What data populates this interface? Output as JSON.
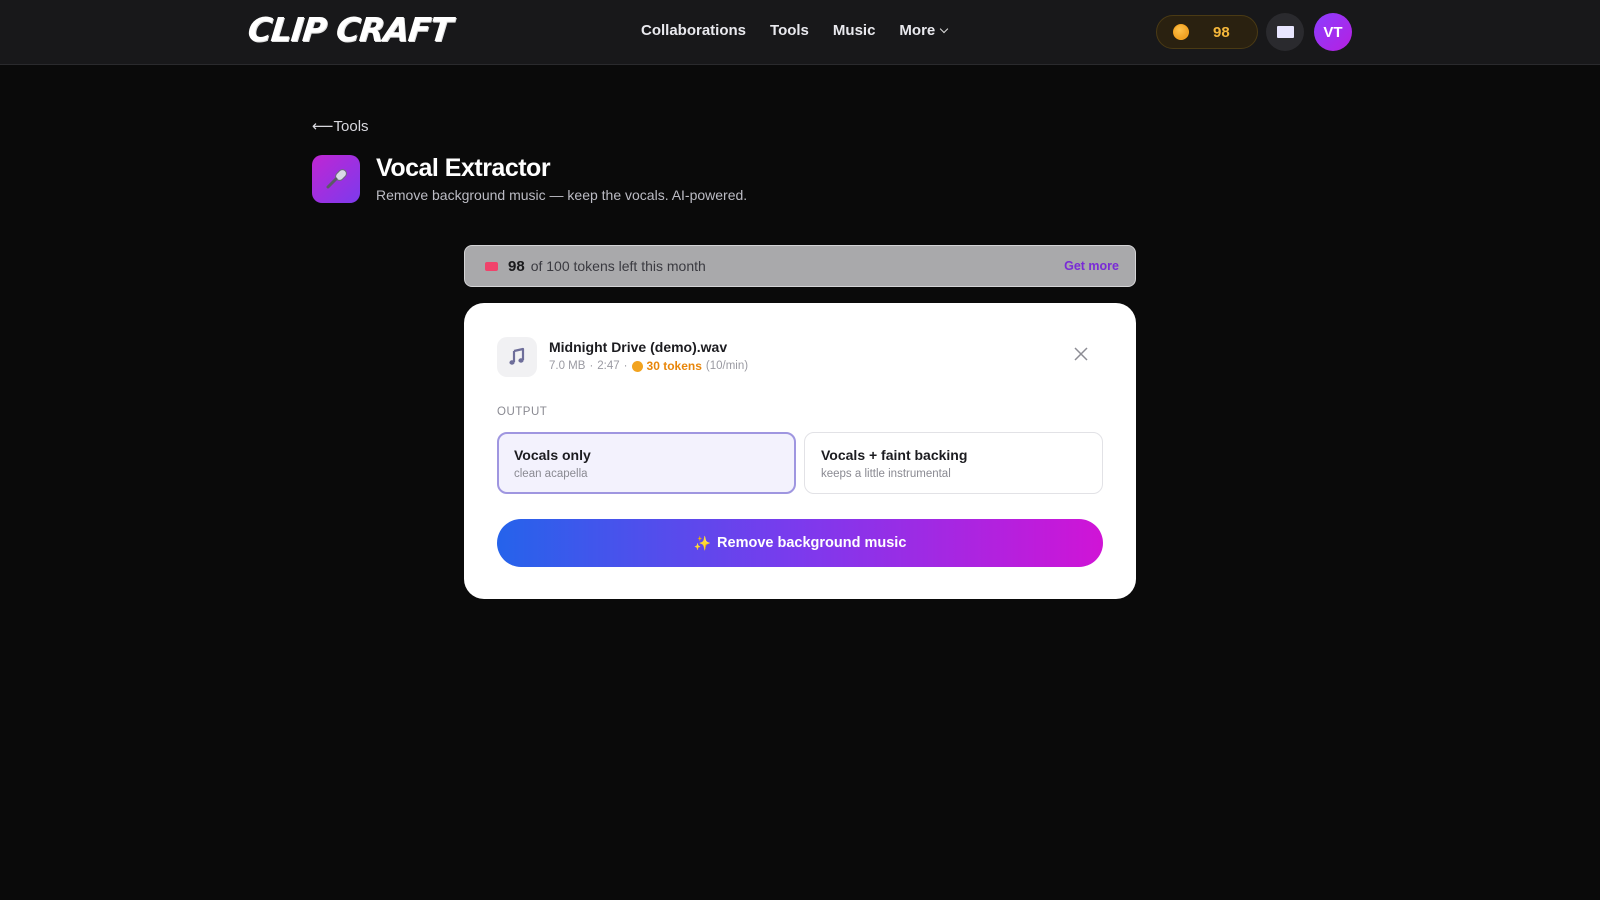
{
  "header": {
    "logo_text": "CLIP CRAFT",
    "nav": [
      {
        "label": "Collaborations"
      },
      {
        "label": "Tools"
      },
      {
        "label": "Music"
      },
      {
        "label": "More"
      }
    ],
    "token_count": "98",
    "avatar_initials": "VT"
  },
  "page": {
    "back_label": "Tools",
    "back_arrow": "⟵",
    "title": "Vocal Extractor",
    "subtitle": "Remove background music — keep the vocals. AI-powered.",
    "icon": "microphone-icon"
  },
  "quota": {
    "remaining": "98",
    "text": "of 100 tokens left this month",
    "get_more": "Get more",
    "used_fraction": 0.02
  },
  "file": {
    "name": "Midnight Drive (demo).wav",
    "size": "7.0 MB",
    "duration": "2:47",
    "cost": "30 tokens",
    "rate": "(10/min)",
    "icon": "music-note-icon"
  },
  "output": {
    "label": "OUTPUT",
    "options": [
      {
        "title": "Vocals only",
        "subtitle": "clean acapella",
        "selected": true
      },
      {
        "title": "Vocals + faint backing",
        "subtitle": "keeps a little instrumental",
        "selected": false
      }
    ]
  },
  "action": {
    "label": "Remove background music",
    "icon": "sparkle-icon"
  },
  "colors": {
    "accent_start": "#2563eb",
    "accent_mid": "#7c3aed",
    "accent_end": "#d014d6",
    "token_gold": "#f5b73b",
    "ticket_pink": "#f0436b"
  }
}
